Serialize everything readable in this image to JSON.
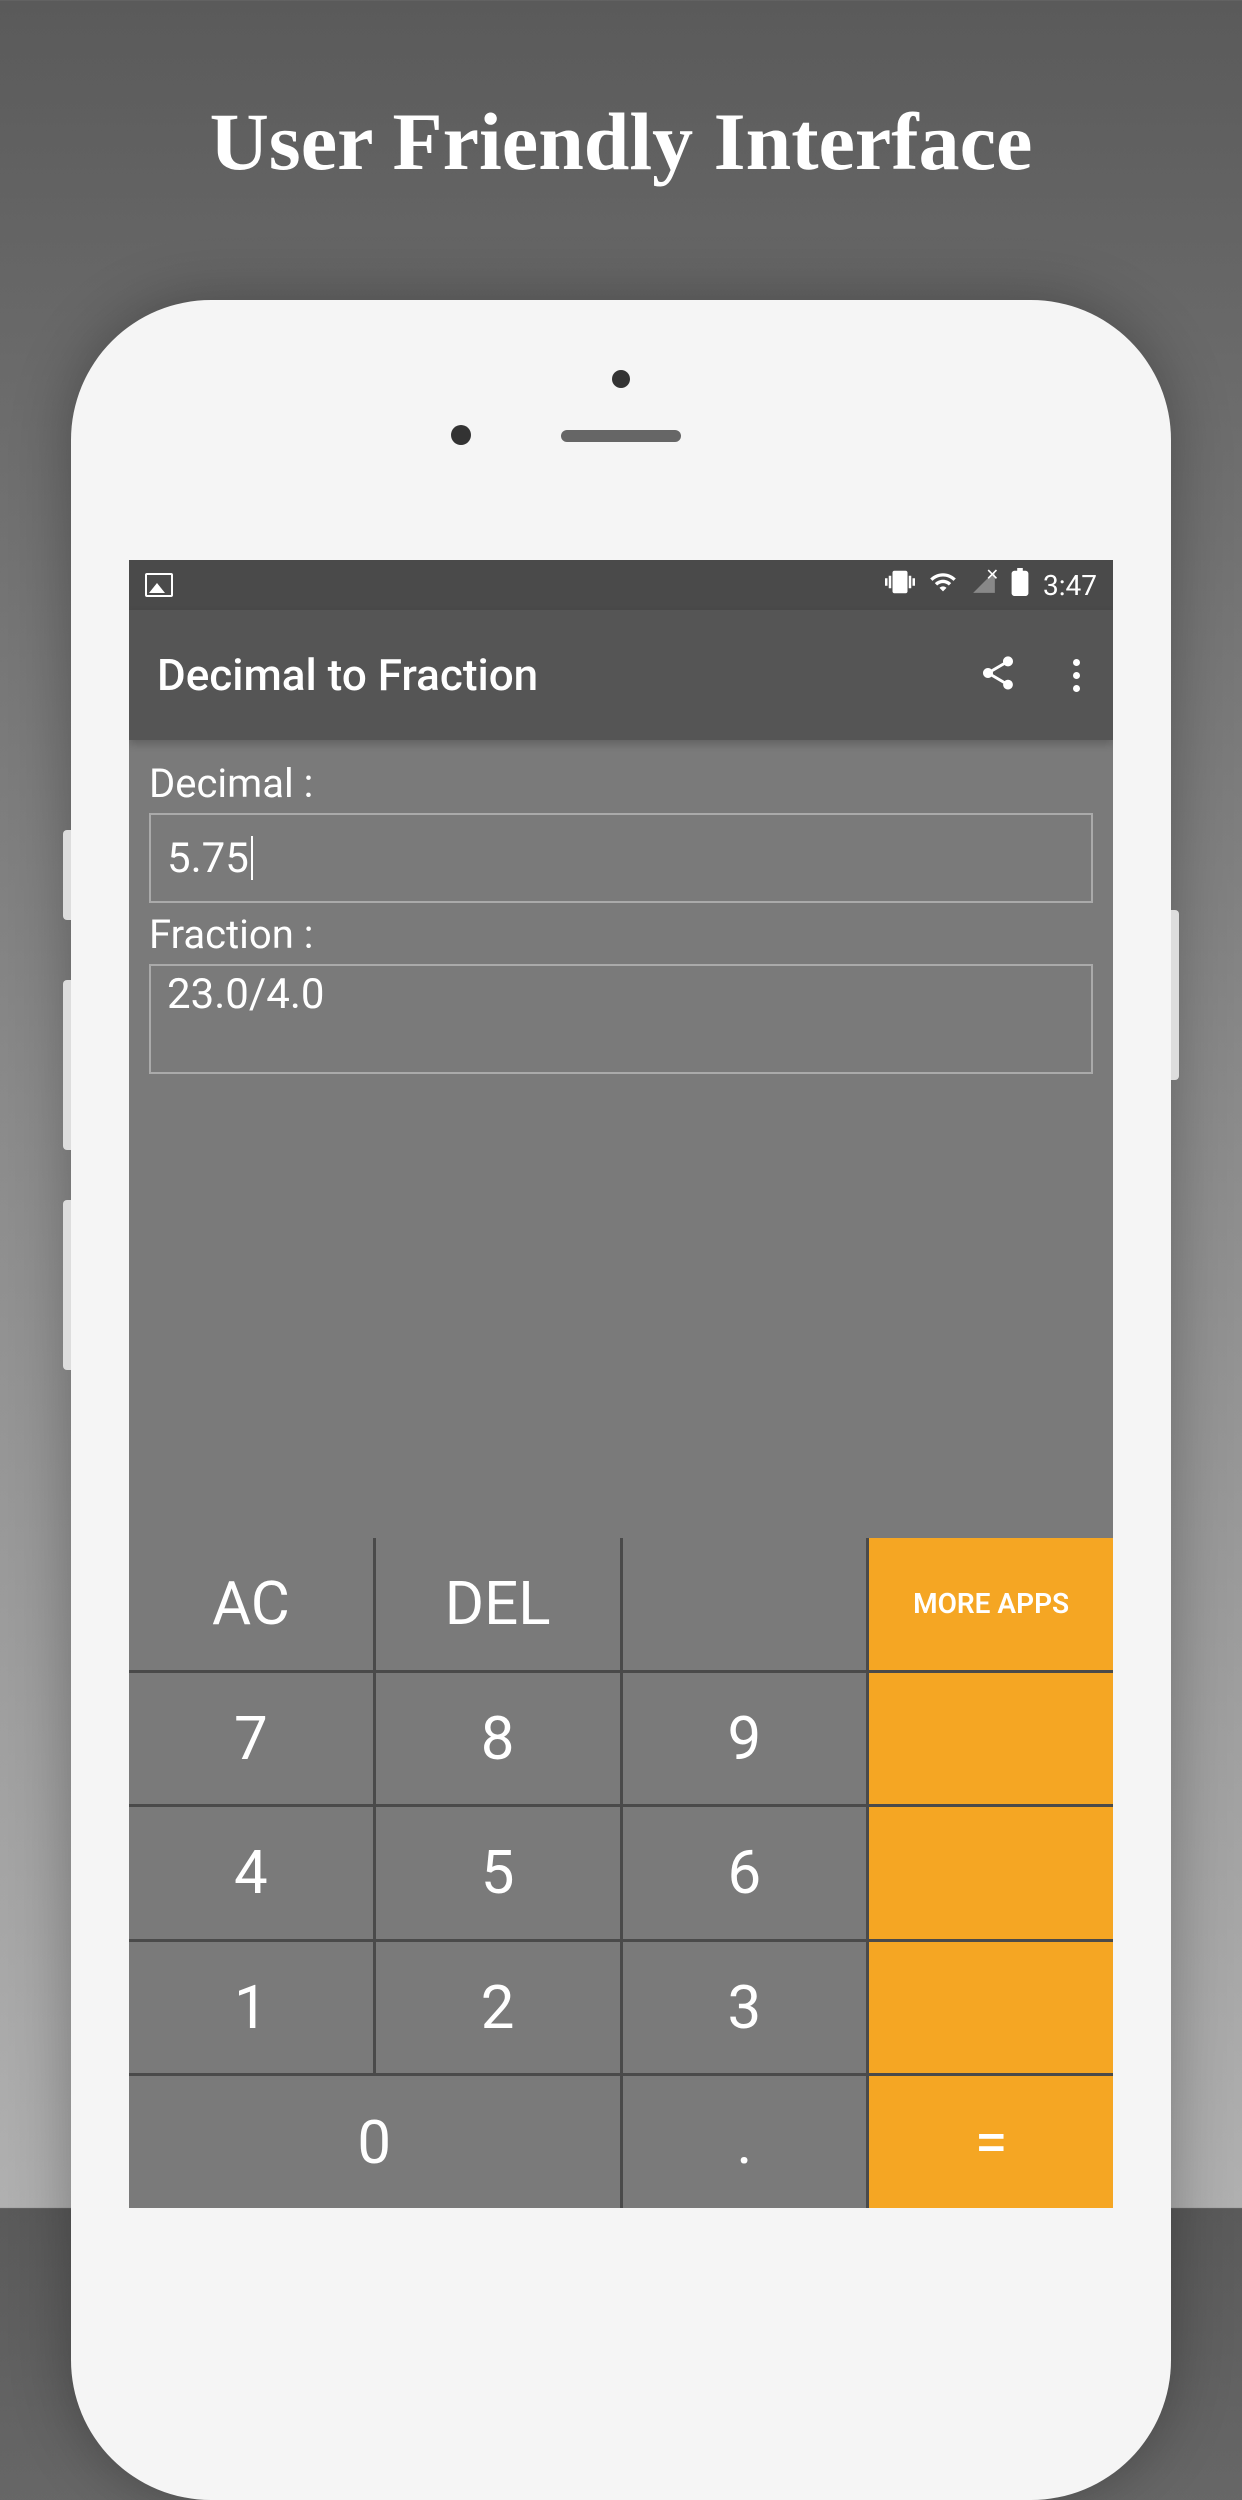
{
  "promo": {
    "title": "User Friendly Interface"
  },
  "statusBar": {
    "time": "3:47"
  },
  "appBar": {
    "title": "Decimal to Fraction"
  },
  "form": {
    "decimalLabel": "Decimal :",
    "decimalValue": "5.75",
    "fractionLabel": "Fraction :",
    "fractionValue": "23.0/4.0"
  },
  "keypad": {
    "ac": "AC",
    "del": "DEL",
    "moreApps": "MORE APPS",
    "seven": "7",
    "eight": "8",
    "nine": "9",
    "four": "4",
    "five": "5",
    "six": "6",
    "one": "1",
    "two": "2",
    "three": "3",
    "zero": "0",
    "dot": ".",
    "equals": "="
  }
}
